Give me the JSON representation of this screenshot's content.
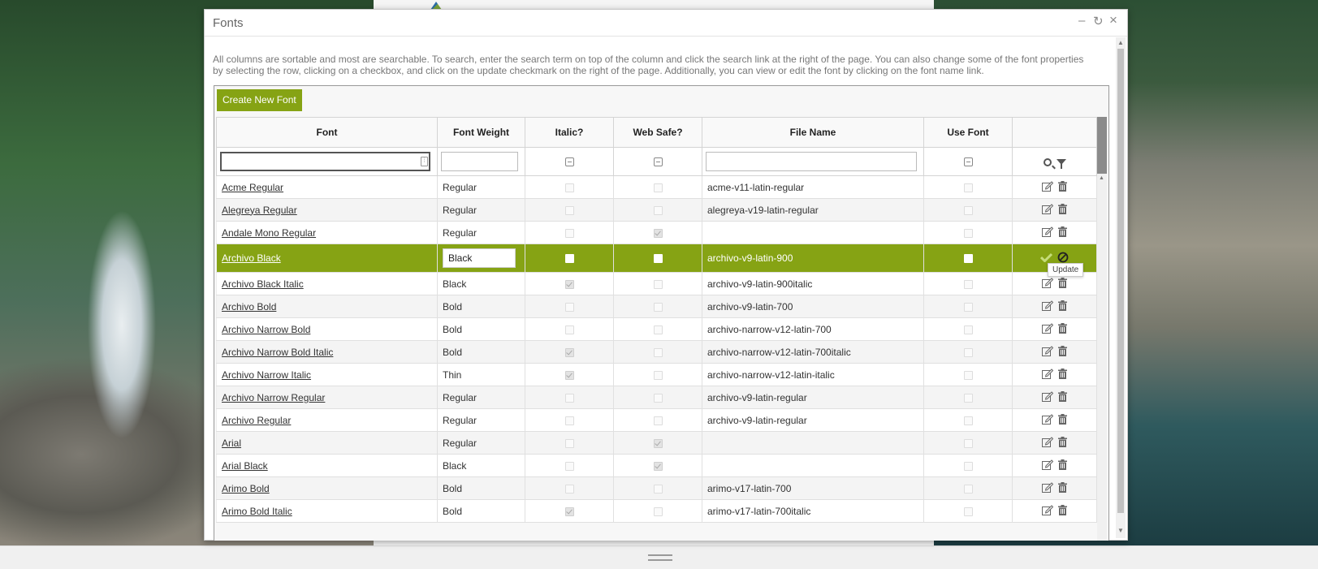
{
  "dialog": {
    "title": "Fonts",
    "controls": {
      "minimize": "–",
      "restore": "↻",
      "close": "×"
    },
    "description": "All columns are sortable and most are searchable. To search, enter the search term on top of the column and click the search link at the right of the page. You can also change some of the font properties by selecting the row, clicking on a checkbox, and click on the update checkmark on the right of the page. Additionally, you can view or edit the font by clicking on the font name link.",
    "create_button": "Create New Font"
  },
  "table": {
    "columns": [
      "Font",
      "Font Weight",
      "Italic?",
      "Web Safe?",
      "File Name",
      "Use Font",
      ""
    ],
    "filters": {
      "font": "",
      "font_weight": "",
      "file_name": ""
    },
    "rows": [
      {
        "font": "Acme Regular",
        "weight": "Regular",
        "italic": false,
        "websafe": false,
        "file": "acme-v11-latin-regular",
        "use": false
      },
      {
        "font": "Alegreya Regular",
        "weight": "Regular",
        "italic": false,
        "websafe": false,
        "file": "alegreya-v19-latin-regular",
        "use": false
      },
      {
        "font": "Andale Mono Regular",
        "weight": "Regular",
        "italic": false,
        "websafe": true,
        "file": "",
        "use": false
      },
      {
        "font": "Archivo Black",
        "weight": "Black",
        "italic": false,
        "websafe": false,
        "file": "archivo-v9-latin-900",
        "use": false,
        "selected": true
      },
      {
        "font": "Archivo Black Italic",
        "weight": "Black",
        "italic": true,
        "websafe": false,
        "file": "archivo-v9-latin-900italic",
        "use": false
      },
      {
        "font": "Archivo Bold",
        "weight": "Bold",
        "italic": false,
        "websafe": false,
        "file": "archivo-v9-latin-700",
        "use": false
      },
      {
        "font": "Archivo Narrow Bold",
        "weight": "Bold",
        "italic": false,
        "websafe": false,
        "file": "archivo-narrow-v12-latin-700",
        "use": false
      },
      {
        "font": "Archivo Narrow Bold Italic",
        "weight": "Bold",
        "italic": true,
        "websafe": false,
        "file": "archivo-narrow-v12-latin-700italic",
        "use": false
      },
      {
        "font": "Archivo Narrow Italic",
        "weight": "Thin",
        "italic": true,
        "websafe": false,
        "file": "archivo-narrow-v12-latin-italic",
        "use": false
      },
      {
        "font": "Archivo Narrow Regular",
        "weight": "Regular",
        "italic": false,
        "websafe": false,
        "file": "archivo-v9-latin-regular",
        "use": false
      },
      {
        "font": "Archivo Regular",
        "weight": "Regular",
        "italic": false,
        "websafe": false,
        "file": "archivo-v9-latin-regular",
        "use": false
      },
      {
        "font": "Arial",
        "weight": "Regular",
        "italic": false,
        "websafe": true,
        "file": "",
        "use": false
      },
      {
        "font": "Arial Black",
        "weight": "Black",
        "italic": false,
        "websafe": true,
        "file": "",
        "use": false
      },
      {
        "font": "Arimo Bold",
        "weight": "Bold",
        "italic": false,
        "websafe": false,
        "file": "arimo-v17-latin-700",
        "use": false
      },
      {
        "font": "Arimo Bold Italic",
        "weight": "Bold",
        "italic": true,
        "websafe": false,
        "file": "arimo-v17-latin-700italic",
        "use": false
      }
    ],
    "tooltip": "Update"
  },
  "colors": {
    "accent": "#86a314"
  }
}
